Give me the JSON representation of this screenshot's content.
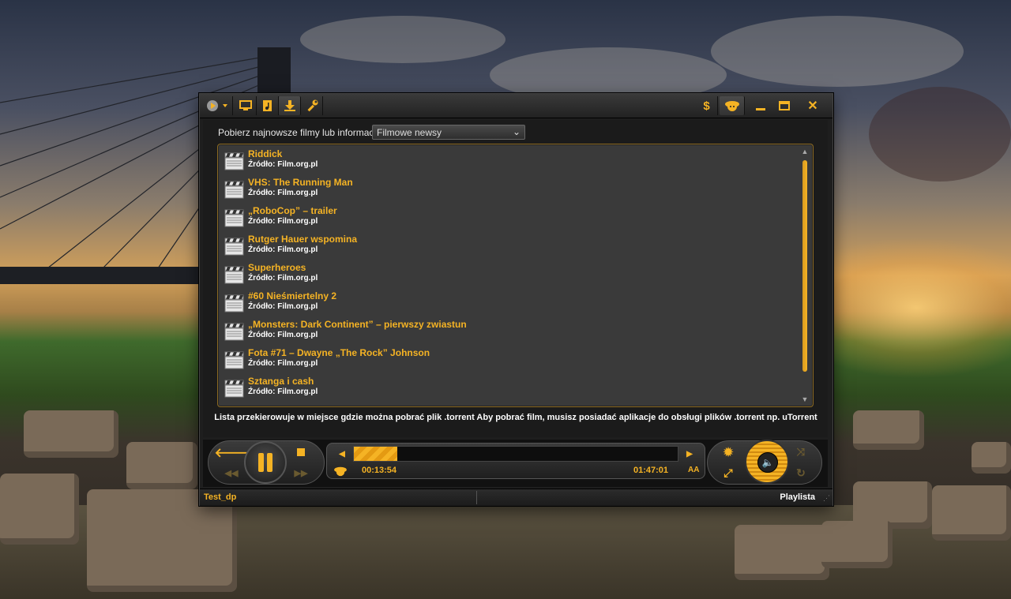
{
  "colors": {
    "accent": "#f5b324",
    "panel": "#3a3a3a",
    "text": "#ffffff"
  },
  "toolbar": {
    "left_icons": [
      "media-menu-icon",
      "monitor-icon",
      "music-file-icon",
      "download-icon",
      "wrench-icon"
    ],
    "right_icons": [
      "dollar-icon",
      "smiley-icon",
      "minimize-icon",
      "maximize-icon",
      "close-icon"
    ]
  },
  "download_panel": {
    "label": "Pobierz najnowsze filmy lub informacje",
    "select_value": "Filmowe newsy",
    "items": [
      {
        "title": "Riddick",
        "source": "Źródło: Film.org.pl"
      },
      {
        "title": "VHS: The Running Man",
        "source": "Źródło: Film.org.pl"
      },
      {
        "title": "„RoboCop” – trailer",
        "source": "Źródło: Film.org.pl"
      },
      {
        "title": "Rutger Hauer wspomina",
        "source": "Źródło: Film.org.pl"
      },
      {
        "title": "Superheroes",
        "source": "Źródło: Film.org.pl"
      },
      {
        "title": "#60 Nieśmiertelny 2",
        "source": "Źródło: Film.org.pl"
      },
      {
        "title": "„Monsters: Dark Continent” – pierwszy zwiastun",
        "source": "Źródło: Film.org.pl"
      },
      {
        "title": "Fota #71 – Dwayne „The Rock” Johnson",
        "source": "Źródło: Film.org.pl"
      },
      {
        "title": "Sztanga i cash",
        "source": "Źródło: Film.org.pl"
      }
    ],
    "note": "Lista przekierowuje w miejsce gdzie można pobrać plik .torrent Aby pobrać film, musisz posiadać aplikacje do obsługi plików .torrent np. uTorrent"
  },
  "player": {
    "elapsed": "00:13:54",
    "total": "01:47:01",
    "progress": 0.135,
    "subtitle_label": "AA"
  },
  "status": {
    "file": "Test_dp",
    "playlist": "Playlista"
  }
}
